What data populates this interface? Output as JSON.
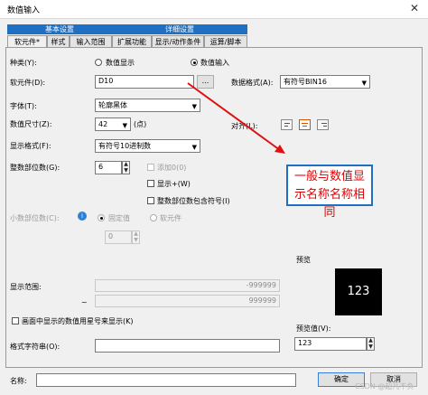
{
  "window": {
    "title": "数值输入",
    "close_glyph": "✕"
  },
  "groups": {
    "basic": "基本设置",
    "detail": "详细设置"
  },
  "tabs": [
    "软元件*",
    "样式",
    "输入范围",
    "扩展功能",
    "显示/动作条件",
    "运算/脚本"
  ],
  "fields": {
    "kind_label": "种类(Y):",
    "kind_option_display": "数值显示",
    "kind_option_input": "数值输入",
    "device_label": "软元件(D):",
    "device_value": "D10",
    "device_browse": "...",
    "data_format_label": "数据格式(A):",
    "data_format_value": "有符号BIN16",
    "font_label": "字体(T):",
    "font_value": "轮廓黑体",
    "size_label": "数值尺寸(Z):",
    "size_value": "42",
    "size_unit": "(点)",
    "align_label": "对齐(L):",
    "display_format_label": "显示格式(F):",
    "display_format_value": "有符号10进制数",
    "int_digits_label": "整数部位数(G):",
    "int_digits_value": "6",
    "add_zero_label": "添加0(0)",
    "show_plus_label": "显示+(W)",
    "include_sign_label": "整数部位数包含符号(I)",
    "decimal_label": "小数部位数(C):",
    "fixed_label": "固定值",
    "device_option_label": "软元件",
    "decimal_value": "0",
    "range_label": "显示范围:",
    "range_min": "-999999",
    "range_tilde": "~",
    "range_max": "999999",
    "asterisk_label": "画面中显示的数值用星号来显示(K)",
    "format_string_label": "格式字符串(O):",
    "format_string_value": ""
  },
  "preview": {
    "title": "预览",
    "display_value": "123",
    "value_label": "预览值(V):",
    "value_input": "123"
  },
  "annotation": "一般与数值显示名称名称相同",
  "footer": {
    "name_label": "名称:",
    "name_value": "",
    "ok": "确定",
    "cancel": "取消",
    "watermark": "CSDN @超凡不负"
  },
  "colors": {
    "accent_blue": "#1f6fc2",
    "annotation_red": "#e00000",
    "arrow_red": "#e01010"
  }
}
